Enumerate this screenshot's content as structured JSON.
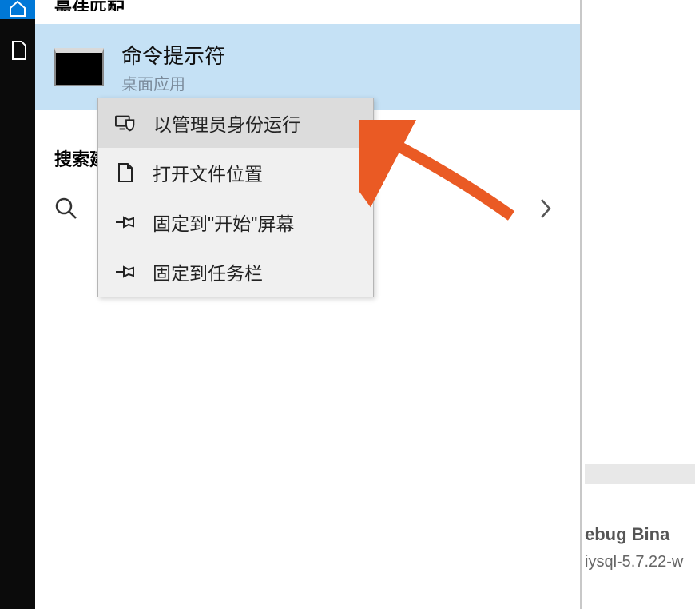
{
  "sections": {
    "best_match_header": "最佳匹配",
    "search_suggest_header": "搜索建议"
  },
  "result": {
    "title": "命令提示符",
    "subtitle": "桌面应用"
  },
  "context_menu": {
    "items": [
      {
        "label": "以管理员身份运行",
        "icon": "shield-monitor"
      },
      {
        "label": "打开文件位置",
        "icon": "folder"
      },
      {
        "label": "固定到\"开始\"屏幕",
        "icon": "pin"
      },
      {
        "label": "固定到任务栏",
        "icon": "pin"
      }
    ]
  },
  "right_panel": {
    "line1": "ebug Bina",
    "line2": "iysql-5.7.22-w"
  }
}
